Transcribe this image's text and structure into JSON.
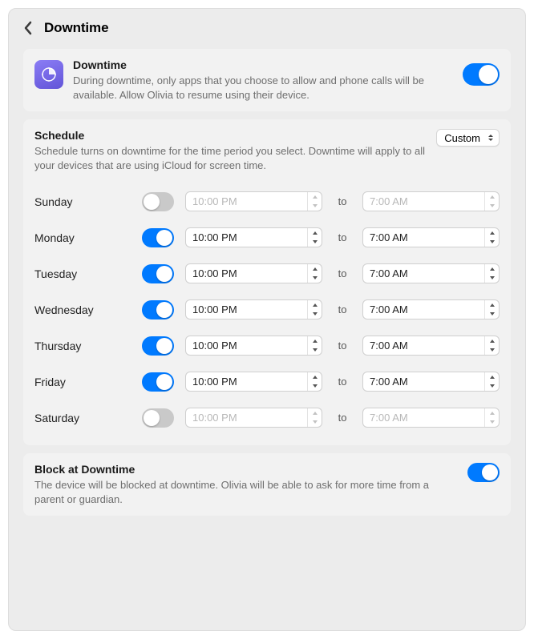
{
  "header": {
    "title": "Downtime"
  },
  "downtime": {
    "title": "Downtime",
    "description": "During downtime, only apps that you choose to allow and phone calls will be available. Allow Olivia to resume using their device.",
    "enabled": true
  },
  "schedule": {
    "title": "Schedule",
    "description": "Schedule turns on downtime for the time period you select. Downtime will apply to all your devices that are using iCloud for screen time.",
    "mode_label": "Custom",
    "to_label": "to",
    "days": [
      {
        "name": "Sunday",
        "enabled": false,
        "start": "10:00 PM",
        "end": "7:00 AM"
      },
      {
        "name": "Monday",
        "enabled": true,
        "start": "10:00 PM",
        "end": "7:00 AM"
      },
      {
        "name": "Tuesday",
        "enabled": true,
        "start": "10:00 PM",
        "end": "7:00 AM"
      },
      {
        "name": "Wednesday",
        "enabled": true,
        "start": "10:00 PM",
        "end": "7:00 AM"
      },
      {
        "name": "Thursday",
        "enabled": true,
        "start": "10:00 PM",
        "end": "7:00 AM"
      },
      {
        "name": "Friday",
        "enabled": true,
        "start": "10:00 PM",
        "end": "7:00 AM"
      },
      {
        "name": "Saturday",
        "enabled": false,
        "start": "10:00 PM",
        "end": "7:00 AM"
      }
    ]
  },
  "block": {
    "title": "Block at Downtime",
    "description": "The device will be blocked at downtime. Olivia will be able to ask for more time from a parent or guardian.",
    "enabled": true
  }
}
